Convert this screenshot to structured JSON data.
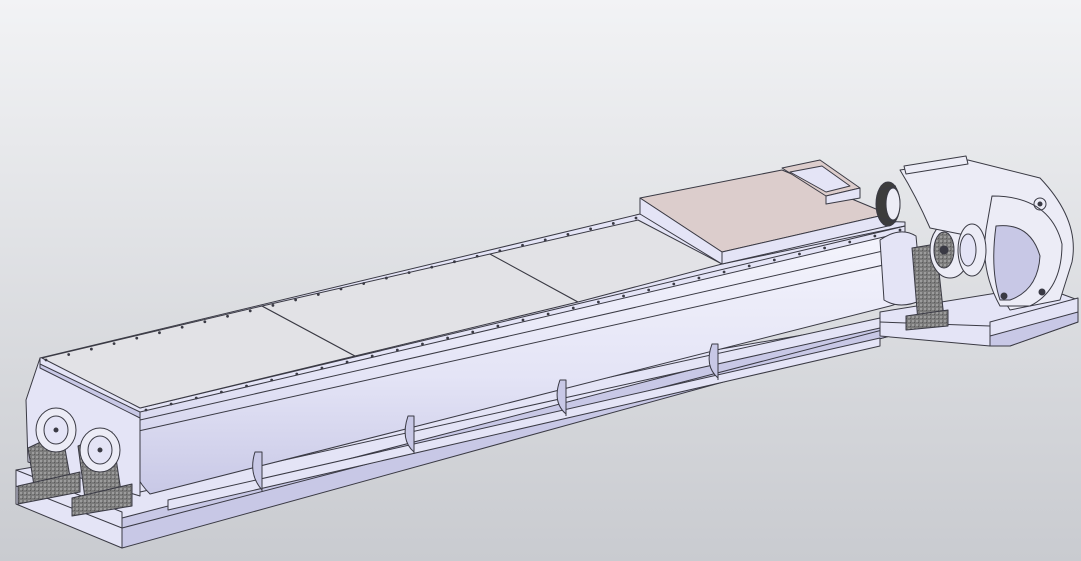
{
  "viewport": {
    "background_top": "#f2f3f5",
    "background_bottom": "#c9cbd0"
  },
  "model": {
    "body_color": "#e4e4f6",
    "body_shade": "#c8c8e6",
    "body_highlight": "#f4f4fc",
    "lid_color": "#e2e2e6",
    "hopper_color": "#dccdcc",
    "edge_color": "#3a3a44",
    "casting_color": "#8a8a8a",
    "gear_color": "#ececf6",
    "coupling_color": "#3c3c3c"
  }
}
